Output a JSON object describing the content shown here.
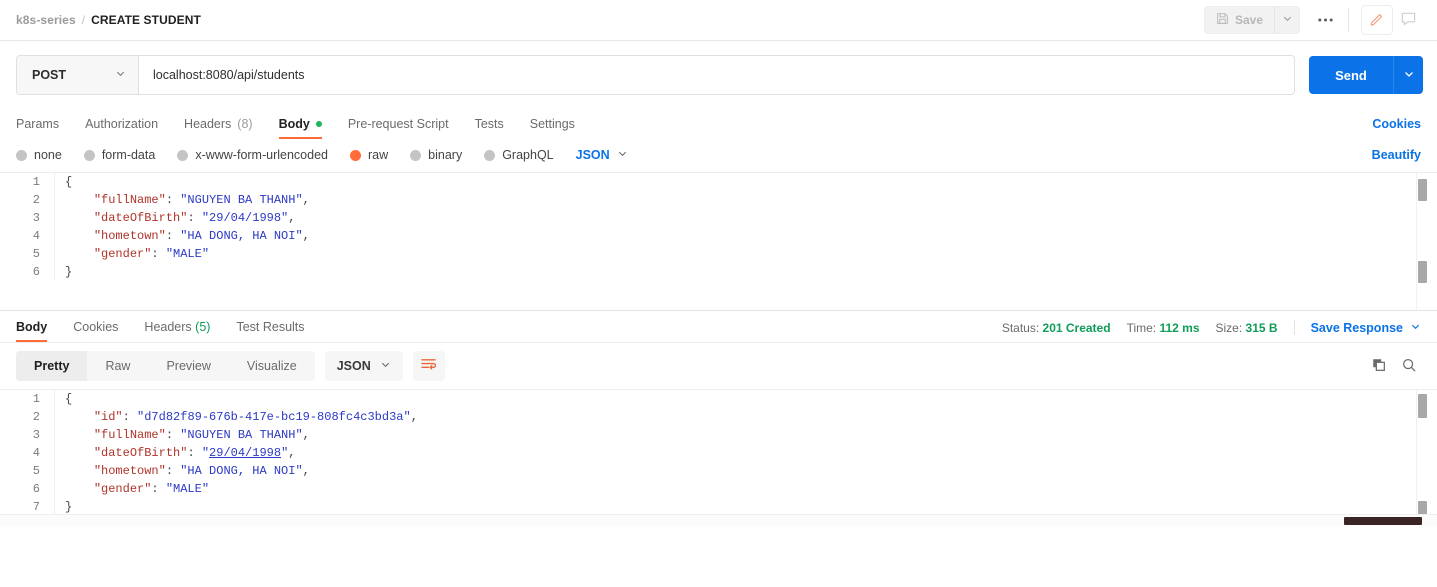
{
  "topbar": {
    "collection": "k8s-series",
    "separator": "/",
    "request_name": "CREATE STUDENT",
    "save_label": "Save",
    "more_label": "ooo",
    "icons": {
      "save": "floppy-disk-icon",
      "save_caret": "chevron-down-icon",
      "more": "ellipsis-icon",
      "edit": "pencil-icon",
      "comment": "comment-icon"
    }
  },
  "urlbar": {
    "method": "POST",
    "url": "localhost:8080/api/students",
    "send_label": "Send",
    "send_caret": "chevron-down-icon"
  },
  "request_tabs": {
    "items": [
      {
        "label": "Params",
        "active": false,
        "count": ""
      },
      {
        "label": "Authorization",
        "active": false,
        "count": ""
      },
      {
        "label": "Headers",
        "active": false,
        "count": "(8)"
      },
      {
        "label": "Body",
        "active": true,
        "count": ""
      },
      {
        "label": "Pre-request Script",
        "active": false,
        "count": ""
      },
      {
        "label": "Tests",
        "active": false,
        "count": ""
      },
      {
        "label": "Settings",
        "active": false,
        "count": ""
      }
    ],
    "cookies_label": "Cookies"
  },
  "body_type": {
    "options": [
      {
        "label": "none",
        "selected": false
      },
      {
        "label": "form-data",
        "selected": false
      },
      {
        "label": "x-www-form-urlencoded",
        "selected": false
      },
      {
        "label": "raw",
        "selected": true
      },
      {
        "label": "binary",
        "selected": false
      },
      {
        "label": "GraphQL",
        "selected": false
      }
    ],
    "format": "JSON",
    "format_caret": "chevron-down-icon",
    "beautify_label": "Beautify"
  },
  "request_body": {
    "lines": [
      {
        "n": "1",
        "segs": [
          {
            "t": "{",
            "c": "p"
          }
        ]
      },
      {
        "n": "2",
        "segs": [
          {
            "t": "    ",
            "c": "ind"
          },
          {
            "t": "\"fullName\"",
            "c": "k"
          },
          {
            "t": ": ",
            "c": "p"
          },
          {
            "t": "\"NGUYEN BA THANH\"",
            "c": "v"
          },
          {
            "t": ",",
            "c": "p"
          }
        ]
      },
      {
        "n": "3",
        "segs": [
          {
            "t": "    ",
            "c": "ind"
          },
          {
            "t": "\"dateOfBirth\"",
            "c": "k"
          },
          {
            "t": ": ",
            "c": "p"
          },
          {
            "t": "\"29/04/1998\"",
            "c": "v"
          },
          {
            "t": ",",
            "c": "p"
          }
        ]
      },
      {
        "n": "4",
        "segs": [
          {
            "t": "    ",
            "c": "ind"
          },
          {
            "t": "\"hometown\"",
            "c": "k"
          },
          {
            "t": ": ",
            "c": "p"
          },
          {
            "t": "\"HA DONG, HA NOI\"",
            "c": "v"
          },
          {
            "t": ",",
            "c": "p"
          }
        ]
      },
      {
        "n": "5",
        "segs": [
          {
            "t": "    ",
            "c": "ind"
          },
          {
            "t": "\"gender\"",
            "c": "k"
          },
          {
            "t": ": ",
            "c": "p"
          },
          {
            "t": "\"MALE\"",
            "c": "v"
          }
        ]
      },
      {
        "n": "6",
        "segs": [
          {
            "t": "}",
            "c": "p"
          }
        ]
      }
    ]
  },
  "response_tabs": {
    "items": [
      {
        "label": "Body",
        "active": true,
        "count": ""
      },
      {
        "label": "Cookies",
        "active": false,
        "count": ""
      },
      {
        "label": "Headers",
        "active": false,
        "count": "(5)"
      },
      {
        "label": "Test Results",
        "active": false,
        "count": ""
      }
    ]
  },
  "response_status": {
    "status_label": "Status:",
    "status_value": "201 Created",
    "time_label": "Time:",
    "time_value": "112 ms",
    "size_label": "Size:",
    "size_value": "315 B",
    "save_response_label": "Save Response",
    "save_response_caret": "chevron-down-icon"
  },
  "response_toolbar": {
    "views": [
      {
        "label": "Pretty",
        "active": true
      },
      {
        "label": "Raw",
        "active": false
      },
      {
        "label": "Preview",
        "active": false
      },
      {
        "label": "Visualize",
        "active": false
      }
    ],
    "format": "JSON",
    "format_caret": "chevron-down-icon",
    "wrap_icon": "text-wrap-icon",
    "copy_icon": "copy-icon",
    "search_icon": "search-icon"
  },
  "response_body": {
    "lines": [
      {
        "n": "1",
        "segs": [
          {
            "t": "{",
            "c": "p"
          }
        ]
      },
      {
        "n": "2",
        "segs": [
          {
            "t": "    ",
            "c": "ind"
          },
          {
            "t": "\"id\"",
            "c": "k"
          },
          {
            "t": ": ",
            "c": "p"
          },
          {
            "t": "\"d7d82f89-676b-417e-bc19-808fc4c3bd3a\"",
            "c": "v"
          },
          {
            "t": ",",
            "c": "p"
          }
        ]
      },
      {
        "n": "3",
        "segs": [
          {
            "t": "    ",
            "c": "ind"
          },
          {
            "t": "\"fullName\"",
            "c": "k"
          },
          {
            "t": ": ",
            "c": "p"
          },
          {
            "t": "\"NGUYEN BA THANH\"",
            "c": "v"
          },
          {
            "t": ",",
            "c": "p"
          }
        ]
      },
      {
        "n": "4",
        "segs": [
          {
            "t": "    ",
            "c": "ind"
          },
          {
            "t": "\"dateOfBirth\"",
            "c": "k"
          },
          {
            "t": ": ",
            "c": "p"
          },
          {
            "t": "\"",
            "c": "v"
          },
          {
            "t": "29/04/1998",
            "c": "v u"
          },
          {
            "t": "\"",
            "c": "v"
          },
          {
            "t": ",",
            "c": "p"
          }
        ]
      },
      {
        "n": "5",
        "segs": [
          {
            "t": "    ",
            "c": "ind"
          },
          {
            "t": "\"hometown\"",
            "c": "k"
          },
          {
            "t": ": ",
            "c": "p"
          },
          {
            "t": "\"HA DONG, HA NOI\"",
            "c": "v"
          },
          {
            "t": ",",
            "c": "p"
          }
        ]
      },
      {
        "n": "6",
        "segs": [
          {
            "t": "    ",
            "c": "ind"
          },
          {
            "t": "\"gender\"",
            "c": "k"
          },
          {
            "t": ": ",
            "c": "p"
          },
          {
            "t": "\"MALE\"",
            "c": "v"
          }
        ]
      },
      {
        "n": "7",
        "segs": [
          {
            "t": "}",
            "c": "p"
          }
        ]
      }
    ]
  }
}
